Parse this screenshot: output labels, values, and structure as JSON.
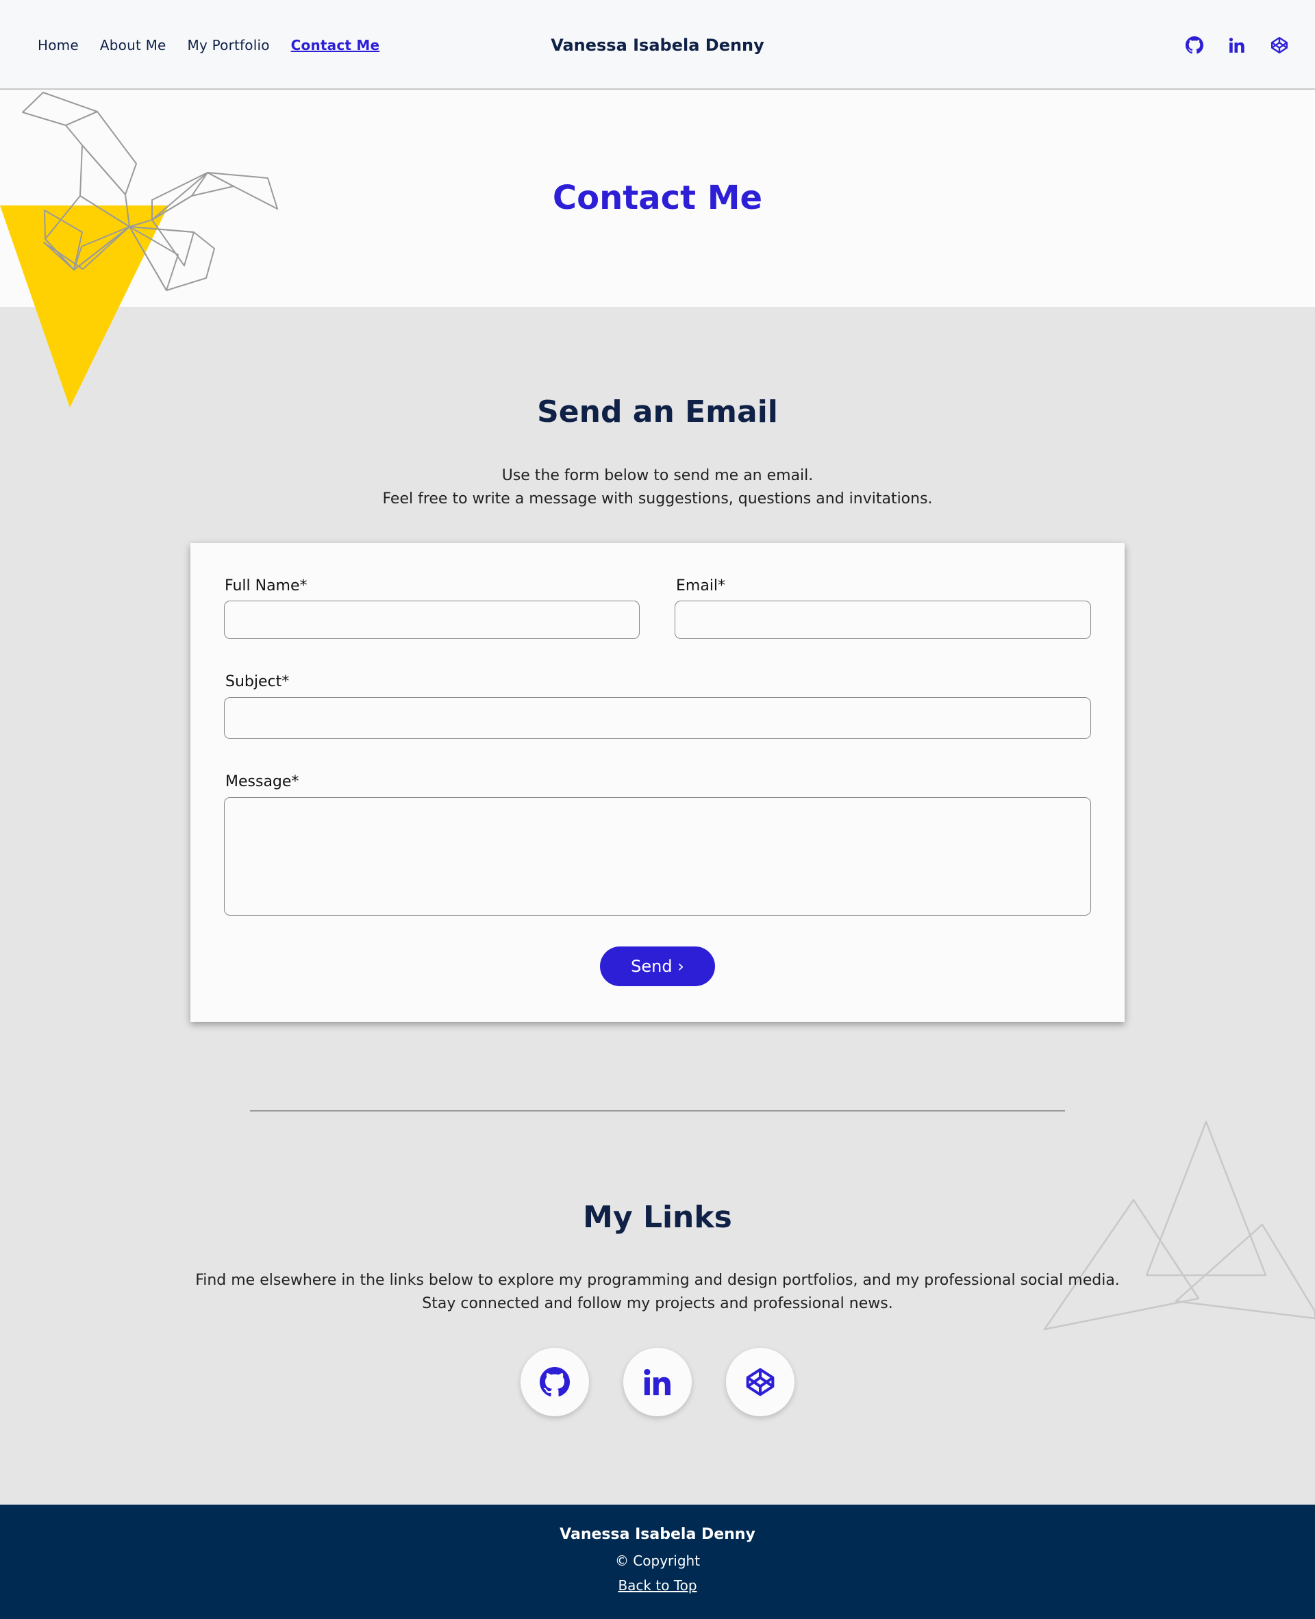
{
  "header": {
    "nav": [
      {
        "label": "Home"
      },
      {
        "label": "About Me"
      },
      {
        "label": "My Portfolio"
      },
      {
        "label": "Contact Me"
      }
    ],
    "brand": "Vanessa Isabela Denny",
    "icons": [
      "github-icon",
      "linkedin-icon",
      "codepen-icon"
    ]
  },
  "hero": {
    "title": "Contact Me"
  },
  "email_section": {
    "title": "Send an Email",
    "line1": "Use the form below to send me an email.",
    "line2": "Feel free to write a message with suggestions, questions and invitations."
  },
  "form": {
    "full_name_label": "Full Name*",
    "full_name_value": "",
    "email_label": "Email*",
    "email_value": "",
    "subject_label": "Subject*",
    "subject_value": "",
    "message_label": "Message*",
    "message_value": "",
    "send_label": "Send ›"
  },
  "links_section": {
    "title": "My Links",
    "line1": "Find me elsewhere in the links below to explore my programming and design portfolios, and my professional social media.",
    "line2": "Stay connected and follow my projects and professional news.",
    "icons": [
      "github-icon",
      "linkedin-icon",
      "codepen-icon"
    ]
  },
  "footer": {
    "name": "Vanessa Isabela Denny",
    "copyright": "©  Copyright",
    "back_to_top": "Back to Top"
  },
  "colors": {
    "accent": "#2d1fd6",
    "navy": "#0f2146",
    "footer_bg": "#002a52",
    "yellow": "#ffd103",
    "page_bg": "#e5e5e5"
  }
}
